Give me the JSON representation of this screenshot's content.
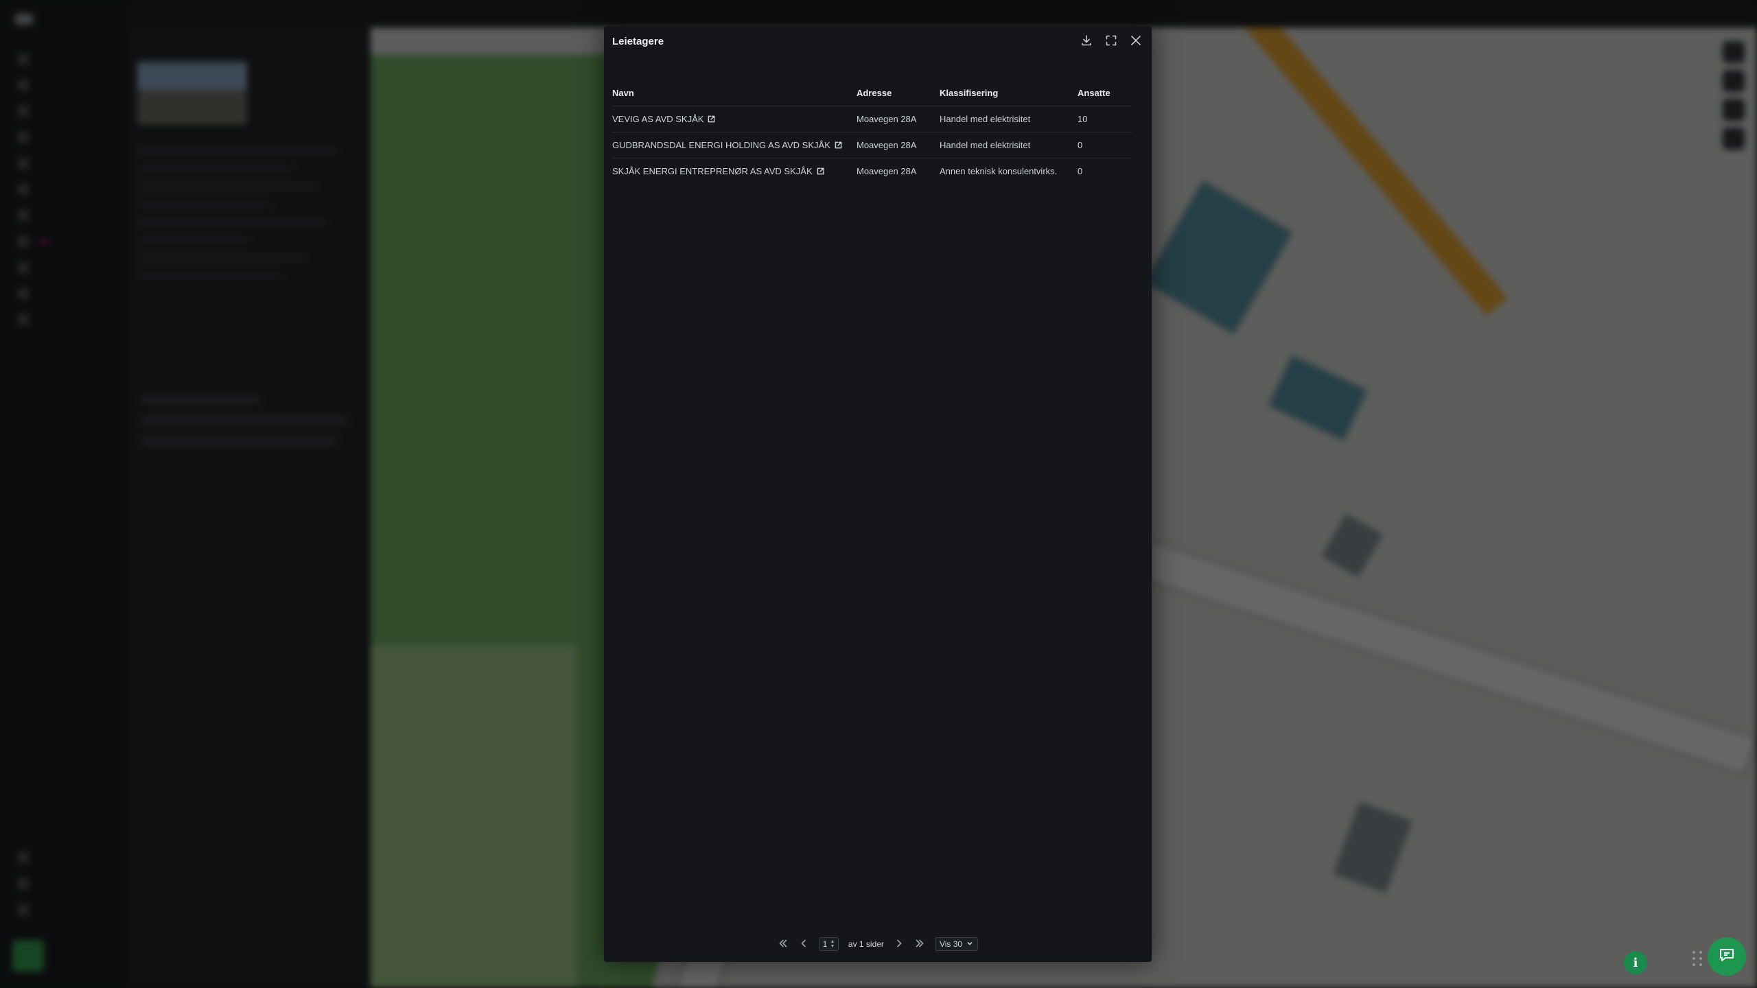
{
  "modal": {
    "title": "Leietagere",
    "tools": [
      "download-icon",
      "expand-icon",
      "close-icon"
    ],
    "columns": {
      "name": "Navn",
      "address": "Adresse",
      "classification": "Klassifisering",
      "employees": "Ansatte"
    },
    "rows": [
      {
        "name": "VEVIG AS AVD SKJÅK",
        "address": "Moavegen 28A",
        "classification": "Handel med elektrisitet",
        "employees": "10"
      },
      {
        "name": "GUDBRANDSDAL ENERGI HOLDING AS AVD SKJÅK",
        "address": "Moavegen 28A",
        "classification": "Handel med elektrisitet",
        "employees": "0"
      },
      {
        "name": "SKJÅK ENERGI ENTREPRENØR AS AVD SKJÅK",
        "address": "Moavegen 28A",
        "classification": "Annen teknisk konsulentvirks.",
        "employees": "0"
      }
    ],
    "pager": {
      "current_page": "1",
      "of_pages": "av 1 sider",
      "page_size": "Vis 30"
    }
  },
  "floating": {
    "info_label": "i"
  },
  "colors": {
    "modal_bg": "#141619",
    "accent_green": "#1d9650",
    "badge_pink": "#e0208a"
  }
}
